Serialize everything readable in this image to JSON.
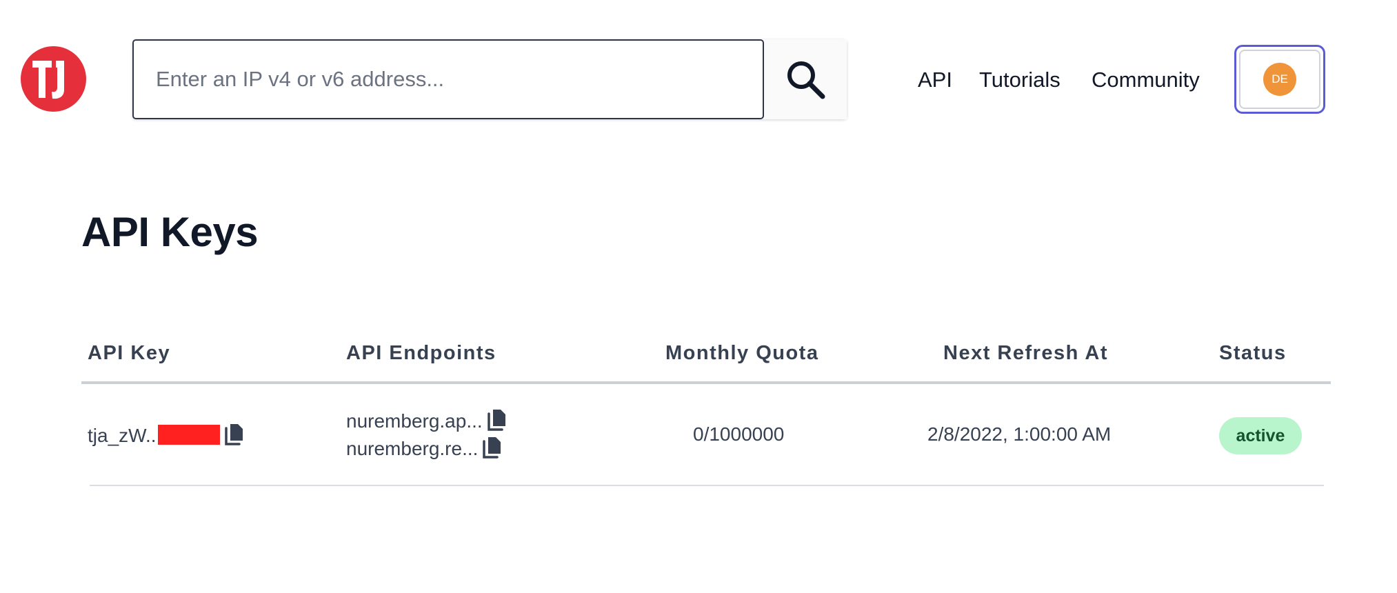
{
  "header": {
    "logo_text": "TJ",
    "search": {
      "placeholder": "Enter an IP v4 or v6 address...",
      "value": ""
    },
    "nav": [
      {
        "label": "API"
      },
      {
        "label": "Tutorials"
      },
      {
        "label": "Community"
      }
    ],
    "avatar_initials": "DE",
    "colors": {
      "logo": "#e5303c",
      "avatar": "#f0943a",
      "focus_ring": "#5b5bd6"
    }
  },
  "main": {
    "title": "API Keys",
    "table": {
      "columns": [
        "API Key",
        "API Endpoints",
        "Monthly Quota",
        "Next Refresh At",
        "Status"
      ],
      "rows": [
        {
          "api_key": "tja_zW..",
          "endpoints": [
            "nuremberg.ap...",
            "nuremberg.re..."
          ],
          "monthly_quota": "0/1000000",
          "next_refresh_at": "2/8/2022, 1:00:00 AM",
          "status": "active"
        }
      ]
    },
    "colors": {
      "status_active_bg": "#b8f5cd",
      "status_active_text": "#14532d",
      "redaction": "#ff2020"
    }
  }
}
